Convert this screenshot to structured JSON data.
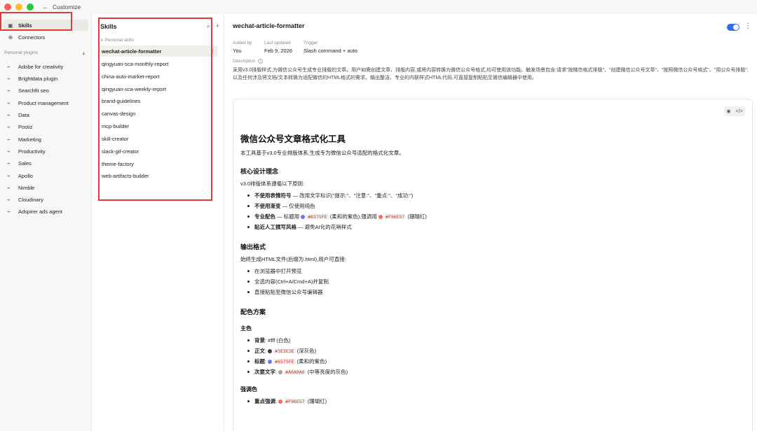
{
  "window": {
    "title": "Customize",
    "back_arrow": "←"
  },
  "left_nav": {
    "items": [
      {
        "label": "Skills",
        "icon": "▣"
      },
      {
        "label": "Connectors",
        "icon": "⊕"
      }
    ],
    "plugins_section": {
      "label": "Personal plugins",
      "plus": "+"
    },
    "plugins": [
      "Adobe for creativity",
      "Brightdata plugin",
      "Searchfit seo",
      "Product management",
      "Data",
      "Postiz",
      "Marketing",
      "Productivity",
      "Sales",
      "Apollo",
      "Nimble",
      "Cloudinary",
      "Adspirer ads agent"
    ]
  },
  "skills_panel": {
    "title": "Skills",
    "search_icon": "⌕",
    "add_icon": "+",
    "personal_label": "∨  Personal skills",
    "items": [
      "wechat-article-formatter",
      "qingyuan-sca-monthly-report",
      "china-auto-market-report",
      "qingyuan-sca-weekly-report",
      "brand-guidelines",
      "canvas-design",
      "mcp-builder",
      "skill-creator",
      "slack-gif-creator",
      "theme-factory",
      "web-artifacts-builder"
    ],
    "selected_kebab": "⋮"
  },
  "detail": {
    "title": "wechat-article-formatter",
    "more": "⋮",
    "added_by": {
      "label": "Added by",
      "value": "You"
    },
    "last_updated": {
      "label": "Last updated",
      "value": "Feb 9, 2026"
    },
    "trigger": {
      "label": "Trigger",
      "value": "Slash command + auto"
    },
    "description_label": "Description",
    "description_info": "i",
    "description": "采用v3.0排版样式,为微信公众号生成专业排版的文章。用户如需创建文章、排版内容,或将内容转换为微信公众号格式,均可使用该功能。触发场景包含:请求\"按微信格式排版\"、\"创建微信公众号文章\"、\"按照微信公众号格式\"、\"用公众号排版\",以及任何涉及将文档/文本转换为适配微信的HTML格式的需求。输出整洁、专业的内联样式HTML代码,可直接复制粘贴至微信编辑器中使用。"
  },
  "preview": {
    "eye_icon": "◉",
    "code_icon": "</>",
    "h1": "微信公众号文章格式化工具",
    "intro": "本工具基于v3.0专业排版体系,生成专为微信公众号适配的格式化文章。",
    "s1_title": "核心设计理念",
    "s1_lead": "v3.0排版体系遵循以下原则:",
    "s1_items": [
      {
        "bold": "不使用表情符号",
        "text": " — 改用文字标识(\"提示:\"、\"注意:\"、\"重点:\"、\"成功:\")"
      },
      {
        "bold": "不使用渐变",
        "text": " — 仅使用纯色"
      },
      {
        "bold": "专业配色",
        "text": " — 标题用 ",
        "code1": "#6575FE",
        "mid": " (柔和的紫色),强调用 ",
        "code2": "#F96E57",
        "tail": " (珊瑚红)"
      },
      {
        "bold": "贴近人工撰写风格",
        "text": " — 避免AI化的花哨样式"
      }
    ],
    "s2_title": "输出格式",
    "s2_lead": "始终生成HTML文件(后缀为.html),用户可直接:",
    "s2_items": [
      "在浏览器中打开预览",
      "全选内容(Ctrl+A/Cmd+A)并复制",
      "直接粘贴至微信公众号编辑器"
    ],
    "s3_title": "配色方案",
    "s3_sub1": "主色",
    "s3_main": [
      {
        "bold": "背景",
        "text": ": #fff (白色)"
      },
      {
        "bold": "正文",
        "text": ": ",
        "code": "#3E3E3E",
        "tail": " (深灰色)",
        "swatch": "#3e3e3e"
      },
      {
        "bold": "标题",
        "text": ": ",
        "code": "#6575FE",
        "tail": " (柔和的紫色)",
        "swatch": "#6575fe"
      },
      {
        "bold": "次要文字",
        "text": ": ",
        "code": "#A0A0A0",
        "tail": " (中等亮度的灰色)",
        "swatch": "#a0a0a0"
      }
    ],
    "s3_sub2": "强调色",
    "s3_accent": [
      {
        "bold": "重点强调",
        "text": ": ",
        "code": "#F96E57",
        "tail": " (珊瑚红)",
        "swatch": "#f96e57"
      }
    ]
  },
  "colors": {
    "accent": "#2f6fe4",
    "annotation": "#e23b3b",
    "purple": "#6575fe",
    "coral": "#f96e57"
  }
}
